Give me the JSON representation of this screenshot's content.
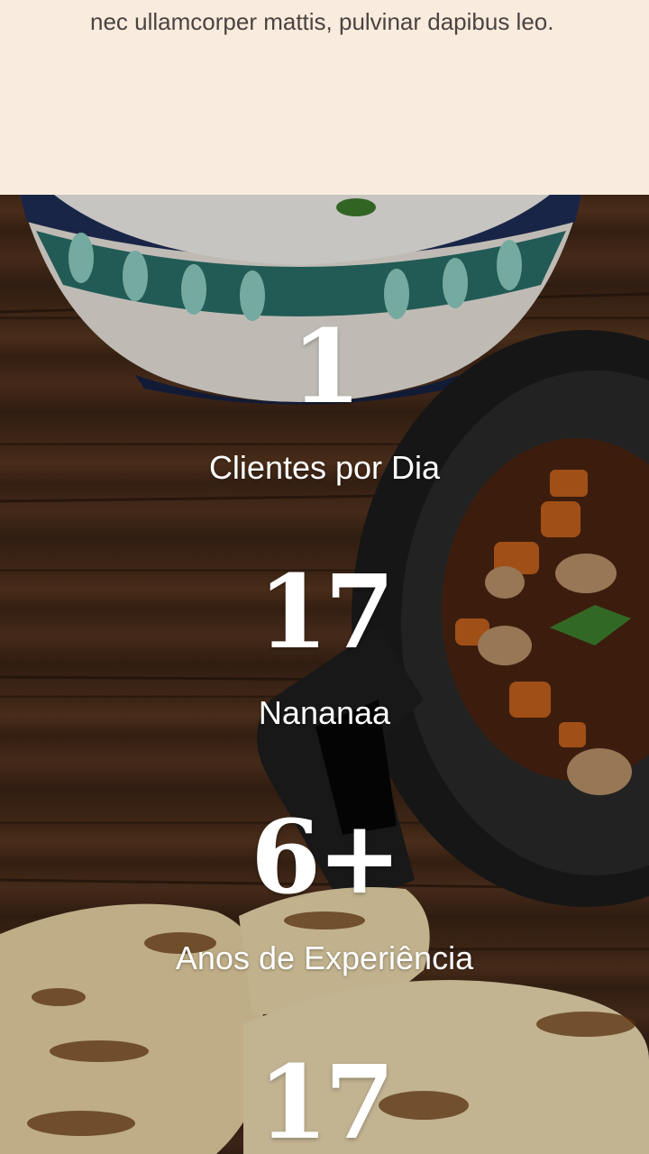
{
  "intro": {
    "text": "nec ullamcorper mattis, pulvinar dapibus leo."
  },
  "stats": [
    {
      "number": "1",
      "label": "Clientes por Dia"
    },
    {
      "number": "17",
      "label": "Nananaa"
    },
    {
      "number": "6+",
      "label": "Anos de Experiência"
    },
    {
      "number": "17",
      "label": ""
    }
  ],
  "colors": {
    "cream_background": "#f9ecde",
    "body_text": "#4a4340",
    "stat_text": "#ffffff",
    "wood": "#4a2d1a"
  }
}
